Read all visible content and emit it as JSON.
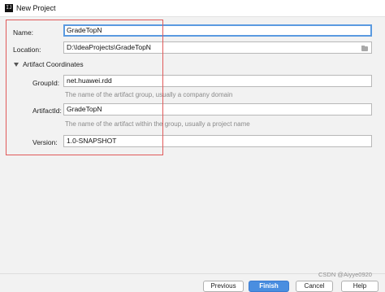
{
  "window": {
    "title": "New Project",
    "app_icon": "intellij-icon"
  },
  "form": {
    "name_label": "Name:",
    "name_value": "GradeTopN",
    "location_label": "Location:",
    "location_value": "D:\\IdeaProjects\\GradeTopN",
    "location_browse_icon": "folder-icon"
  },
  "artifact": {
    "section_label": "Artifact Coordinates",
    "expanded": true,
    "groupid_label": "GroupId:",
    "groupid_value": "net.huawei.rdd",
    "groupid_hint": "The name of the artifact group, usually a company domain",
    "artifactid_label": "ArtifactId:",
    "artifactid_value": "GradeTopN",
    "artifactid_hint": "The name of the artifact within the group, usually a project name",
    "version_label": "Version:",
    "version_value": "1.0-SNAPSHOT"
  },
  "footer": {
    "previous": "Previous",
    "finish": "Finish",
    "cancel": "Cancel",
    "help": "Help"
  },
  "watermark": "CSDN @Aiyye0920",
  "colors": {
    "highlight": "#e05a5a",
    "focus": "#5a9ae0",
    "primary": "#4a8ee0"
  }
}
